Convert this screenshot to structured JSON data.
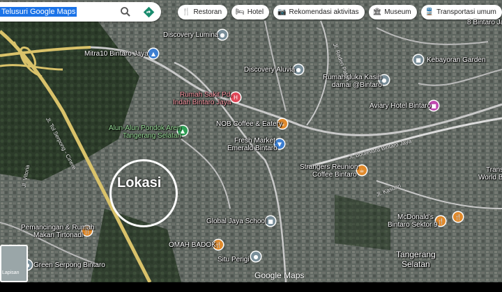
{
  "search": {
    "text": "Telusuri Google Maps"
  },
  "chips": [
    {
      "icon": "🍴",
      "label": "Restoran"
    },
    {
      "icon": "🛏",
      "label": "Hotel"
    },
    {
      "icon": "📷",
      "label": "Rekomendasi aktivitas"
    },
    {
      "icon": "🏛",
      "label": "Museum"
    },
    {
      "icon": "🚆",
      "label": "Transportasi umum"
    }
  ],
  "places": {
    "discovery_lumina": "Discovery Lumina",
    "mitra10": "Mitra10 Bintaro Jaya",
    "discovery_aluvia": "Discovery Aluvia",
    "kebayoran_garden": "Kebayoran Garden",
    "bintaro_sektor": "8 Bintaro Jaya",
    "rumah_duka_1": "Rumah duka Kasih",
    "rumah_duka_2": "damai @Bintaro",
    "rs_1": "Rumah Sakit Pd.",
    "rs_2": "Indah Bintaro Jaya",
    "aviary": "Aviary Hotel Bintaro",
    "alun_1": "Alun-Alun Pondok Aren",
    "alun_2": "Tangerang Selatan",
    "nob": "NOB Coffee & Eatery",
    "fresh_1": "Fresh Market",
    "fresh_2": "Emerald Bintaro",
    "strangers_1": "Strangers Reunion",
    "strangers_2": "Coffee Bintaro",
    "trans_1": "Trans",
    "trans_2": "World B",
    "pemancingan_1": "Pemancingan & Rumah",
    "pemancingan_2": "Makan Tirtonadi",
    "global_jaya": "Global Jaya School",
    "mcd_1": "McDonald's",
    "mcd_2": "Bintaro Sektor 9",
    "omah_badok": "OMAH BADOK",
    "tangsel_1": "Tangerang",
    "tangsel_2": "Selatan",
    "situ_perigi": "Situ Perigi",
    "green_serpong": "Green Serpong Bintaro"
  },
  "streets": {
    "boulevard": "Jl. Boulevard Bintaro Jaya",
    "kasuari": "Jl. Kasuari",
    "raden_patah": "Jl. Raden Patah",
    "serpong": "Jl. Tol Serpong - Cinere",
    "vitoria": "Jl. Vitoria"
  },
  "lokasi": "Lokasi",
  "layer_label": "Lapisan",
  "brand": "Google Maps"
}
